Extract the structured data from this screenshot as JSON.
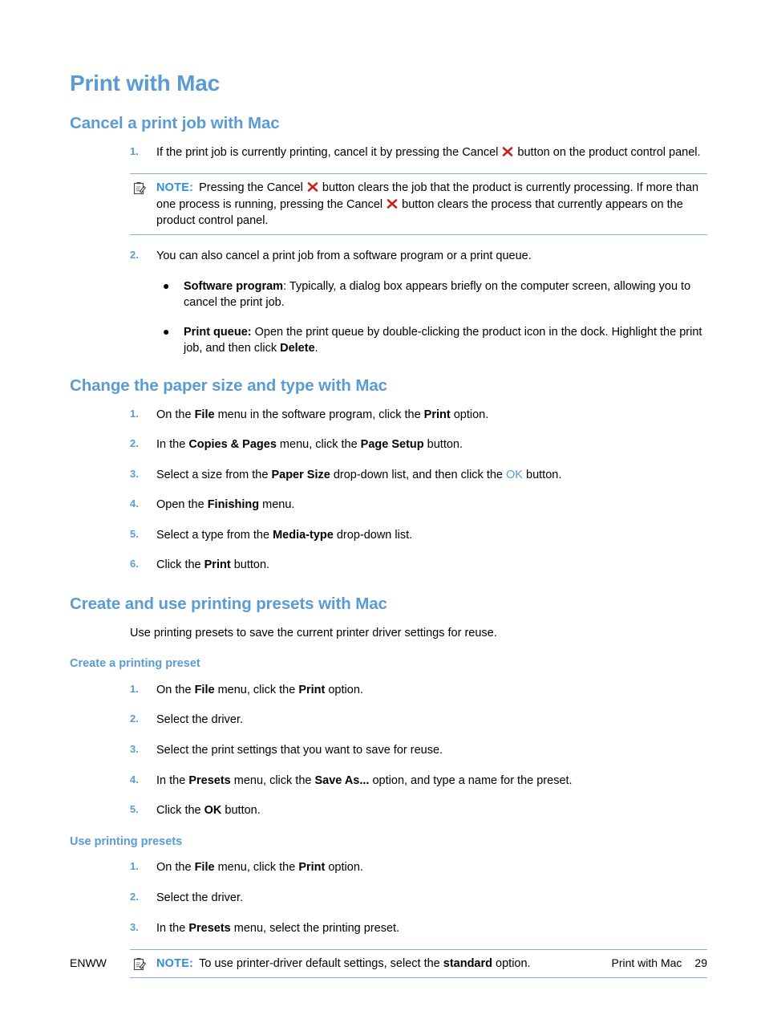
{
  "page": {
    "title": "Print with Mac",
    "footer_left": "ENWW",
    "footer_title": "Print with Mac",
    "footer_page_number": "29"
  },
  "colors": {
    "heading_blue": "#5b9bd5",
    "note_label_blue": "#2f8fd8",
    "note_rule_blue": "#7fb2e0",
    "cancel_icon_red": "#cc2222",
    "body_text": "#000000"
  },
  "sections": [
    {
      "heading": "Cancel a print job with Mac",
      "steps": [
        {
          "number": "1.",
          "text_before_icon": "If the print job is currently printing, cancel it by pressing the Cancel ",
          "text_after_icon": " button on the product control panel."
        },
        {
          "number": "2.",
          "text": "You can also cancel a print job from a software program or a print queue."
        }
      ],
      "note": {
        "label": "NOTE:",
        "part1": "Pressing the Cancel ",
        "part2": " button clears the job that the product is currently processing. If more than one process is running, pressing the Cancel ",
        "part3": " button clears the process that currently appears on the product control panel."
      },
      "bullets": [
        {
          "bullet": "●",
          "bold_lead": "Software program",
          "lead_suffix": ":",
          "text": " Typically, a dialog box appears briefly on the computer screen, allowing you to cancel the print job."
        },
        {
          "bullet": "●",
          "bold_lead": "Print queue:",
          "lead_suffix": "",
          "text": " Open the print queue by double-clicking the product icon in the dock. Highlight the print job, and then click ",
          "bold_tail": "Delete",
          "tail_suffix": "."
        }
      ]
    },
    {
      "heading": "Change the paper size and type with Mac",
      "steps": [
        {
          "number": "1.",
          "a": "On the ",
          "b1": "File",
          "c": " menu in the software program, click the ",
          "b2": "Print",
          "d": " option."
        },
        {
          "number": "2.",
          "a": "In the ",
          "b1": "Copies & Pages",
          "c": " menu, click the ",
          "b2": "Page Setup",
          "d": " button."
        },
        {
          "number": "3.",
          "a": "Select a size from the ",
          "b1": "Paper Size",
          "c": " drop-down list, and then click the ",
          "link": "OK",
          "d": " button."
        },
        {
          "number": "4.",
          "a": "Open the ",
          "b1": "Finishing",
          "c": " menu.",
          "b2": "",
          "d": ""
        },
        {
          "number": "5.",
          "a": "Select a type from the ",
          "b1": "Media-type",
          "c": " drop-down list.",
          "b2": "",
          "d": ""
        },
        {
          "number": "6.",
          "a": "Click the ",
          "b1": "Print",
          "c": " button.",
          "b2": "",
          "d": ""
        }
      ]
    },
    {
      "heading": "Create and use printing presets with Mac",
      "intro": "Use printing presets to save the current printer driver settings for reuse.",
      "subsections": [
        {
          "heading": "Create a printing preset",
          "steps": [
            {
              "number": "1.",
              "a": "On the ",
              "b1": "File",
              "c": " menu, click the ",
              "b2": "Print",
              "d": " option."
            },
            {
              "number": "2.",
              "a": "Select the driver.",
              "b1": "",
              "c": "",
              "b2": "",
              "d": ""
            },
            {
              "number": "3.",
              "a": "Select the print settings that you want to save for reuse.",
              "b1": "",
              "c": "",
              "b2": "",
              "d": ""
            },
            {
              "number": "4.",
              "a": "In the ",
              "b1": "Presets",
              "c": " menu, click the ",
              "b2": "Save As...",
              "d": " option, and type a name for the preset."
            },
            {
              "number": "5.",
              "a": "Click the ",
              "b1": "OK",
              "c": " button.",
              "b2": "",
              "d": ""
            }
          ]
        },
        {
          "heading": "Use printing presets",
          "steps": [
            {
              "number": "1.",
              "a": "On the ",
              "b1": "File",
              "c": " menu, click the ",
              "b2": "Print",
              "d": " option."
            },
            {
              "number": "2.",
              "a": "Select the driver.",
              "b1": "",
              "c": "",
              "b2": "",
              "d": ""
            },
            {
              "number": "3.",
              "a": "In the ",
              "b1": "Presets",
              "c": " menu, select the printing preset.",
              "b2": "",
              "d": ""
            }
          ],
          "note": {
            "label": "NOTE:",
            "part1": "To use printer-driver default settings, select the ",
            "bold": "standard",
            "part2": " option."
          }
        }
      ]
    }
  ]
}
